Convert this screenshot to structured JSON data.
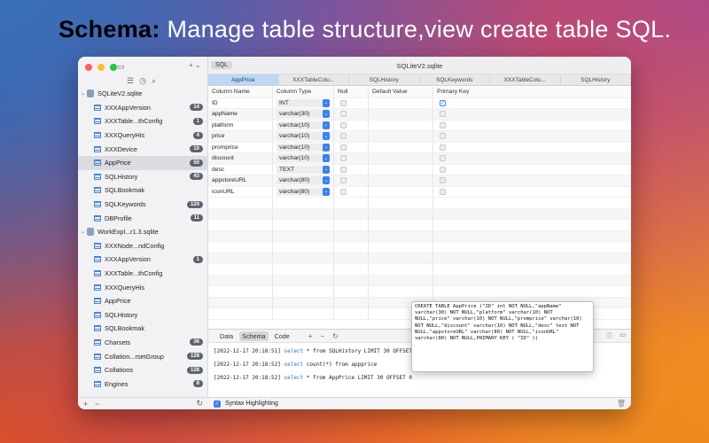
{
  "headline": {
    "strong": "Schema:",
    "rest": " Manage table structure,view create table SQL."
  },
  "colors": {
    "accent": "#3b82f0",
    "tab_active": "#bcd8f5",
    "badge": "#5c6470"
  },
  "sidebar": {
    "top_icons": [
      "sidebar-toggle-icon",
      "plus-icon",
      "chevron-down-icon"
    ],
    "tools": [
      "list-icon",
      "clock-icon",
      "search-icon"
    ],
    "tree": [
      {
        "kind": "db",
        "label": "SQLiteV2.sqlite"
      },
      {
        "kind": "table",
        "label": "XXXAppVersion",
        "badge": "14"
      },
      {
        "kind": "table",
        "label": "XXXTable...thConfig",
        "badge": "1"
      },
      {
        "kind": "table",
        "label": "XXXQueryHis",
        "badge": "4"
      },
      {
        "kind": "table",
        "label": "XXXDevice",
        "badge": "10"
      },
      {
        "kind": "table",
        "label": "AppPrice",
        "badge": "50",
        "selected": true
      },
      {
        "kind": "table",
        "label": "SQLHistory",
        "badge": "43"
      },
      {
        "kind": "table",
        "label": "SQLBookmak",
        "badge": ""
      },
      {
        "kind": "table",
        "label": "SQLKeywords",
        "badge": "124"
      },
      {
        "kind": "table",
        "label": "DBProfile",
        "badge": "11"
      },
      {
        "kind": "db",
        "label": "WorkExpl...r1.3.sqlite"
      },
      {
        "kind": "table",
        "label": "XXXNode...ndConfig",
        "badge": ""
      },
      {
        "kind": "table",
        "label": "XXXAppVersion",
        "badge": "1"
      },
      {
        "kind": "table",
        "label": "XXXTable...thConfig",
        "badge": ""
      },
      {
        "kind": "table",
        "label": "XXXQueryHis",
        "badge": ""
      },
      {
        "kind": "table",
        "label": "AppPrice",
        "badge": ""
      },
      {
        "kind": "table",
        "label": "SQLHistory",
        "badge": ""
      },
      {
        "kind": "table",
        "label": "SQLBookmak",
        "badge": ""
      },
      {
        "kind": "table",
        "label": "Charsets",
        "badge": "36"
      },
      {
        "kind": "table",
        "label": "Collation...rsetGroup",
        "badge": "128"
      },
      {
        "kind": "table",
        "label": "Collations",
        "badge": "128"
      },
      {
        "kind": "table",
        "label": "Engines",
        "badge": "8"
      }
    ],
    "bottom": {
      "add": "+",
      "remove": "−",
      "refresh": "↻"
    }
  },
  "main": {
    "sql_pill": "SQL",
    "plus": "+ ⌄",
    "window_title": "SQLiteV2.sqlite",
    "tabs": [
      "AppPrice",
      "XXXTableColu...",
      "SQLHistory",
      "SQLKeywords",
      "XXXTableColu...",
      "SQLHistory"
    ],
    "columns": [
      "Column Name",
      "Column Type",
      "Null",
      "Default Value",
      "Primary Key"
    ],
    "rows": [
      {
        "name": "ID",
        "type": "INT",
        "pk": true
      },
      {
        "name": "appName",
        "type": "varchar(30)",
        "pk": false
      },
      {
        "name": "platform",
        "type": "varchar(10)",
        "pk": false
      },
      {
        "name": "price",
        "type": "varchar(10)",
        "pk": false
      },
      {
        "name": "promprice",
        "type": "varchar(10)",
        "pk": false
      },
      {
        "name": "discount",
        "type": "varchar(10)",
        "pk": false
      },
      {
        "name": "desc",
        "type": "TEXT",
        "pk": false
      },
      {
        "name": "appstoreURL",
        "type": "varchar(80)",
        "pk": false
      },
      {
        "name": "iconURL",
        "type": "varchar(80)",
        "pk": false
      }
    ],
    "bottom_tabs": [
      "Data",
      "Schema",
      "Code"
    ],
    "bottom_icons": {
      "add": "+",
      "remove": "−",
      "refresh": "↻"
    },
    "log": [
      {
        "ts": "[2022-12-17 20:18:51]",
        "sql_kw": "select",
        "sql_rest": " * from SQLHistory  LIMIT 30 OFFSET 0"
      },
      {
        "ts": "[2022-12-17 20:18:52]",
        "sql_kw": "select",
        "sql_rest": " count(*) from  appprice"
      },
      {
        "ts": "[2022-12-17 20:18:52]",
        "sql_kw": "select",
        "sql_rest": " * from AppPrice  LIMIT 30 OFFSET 0"
      }
    ],
    "footer": {
      "syntax_label": "Syntax Highlighting",
      "check": "✓"
    }
  },
  "popup": {
    "sql": "CREATE TABLE AppPrice (\"ID\" int NOT NULL,\"appName\" varchar(30) NOT NULL,\"platform\" varchar(10) NOT NULL,\"price\" varchar(10) NOT NULL,\"promprice\" varchar(10) NOT NULL,\"discount\" varchar(10) NOT NULL,\"desc\" text NOT NULL,\"appstoreURL\" varchar(80) NOT NULL,\"iconURL\" varchar(80) NOT NULL,PRIMARY KEY ( \"ID\" ))"
  }
}
